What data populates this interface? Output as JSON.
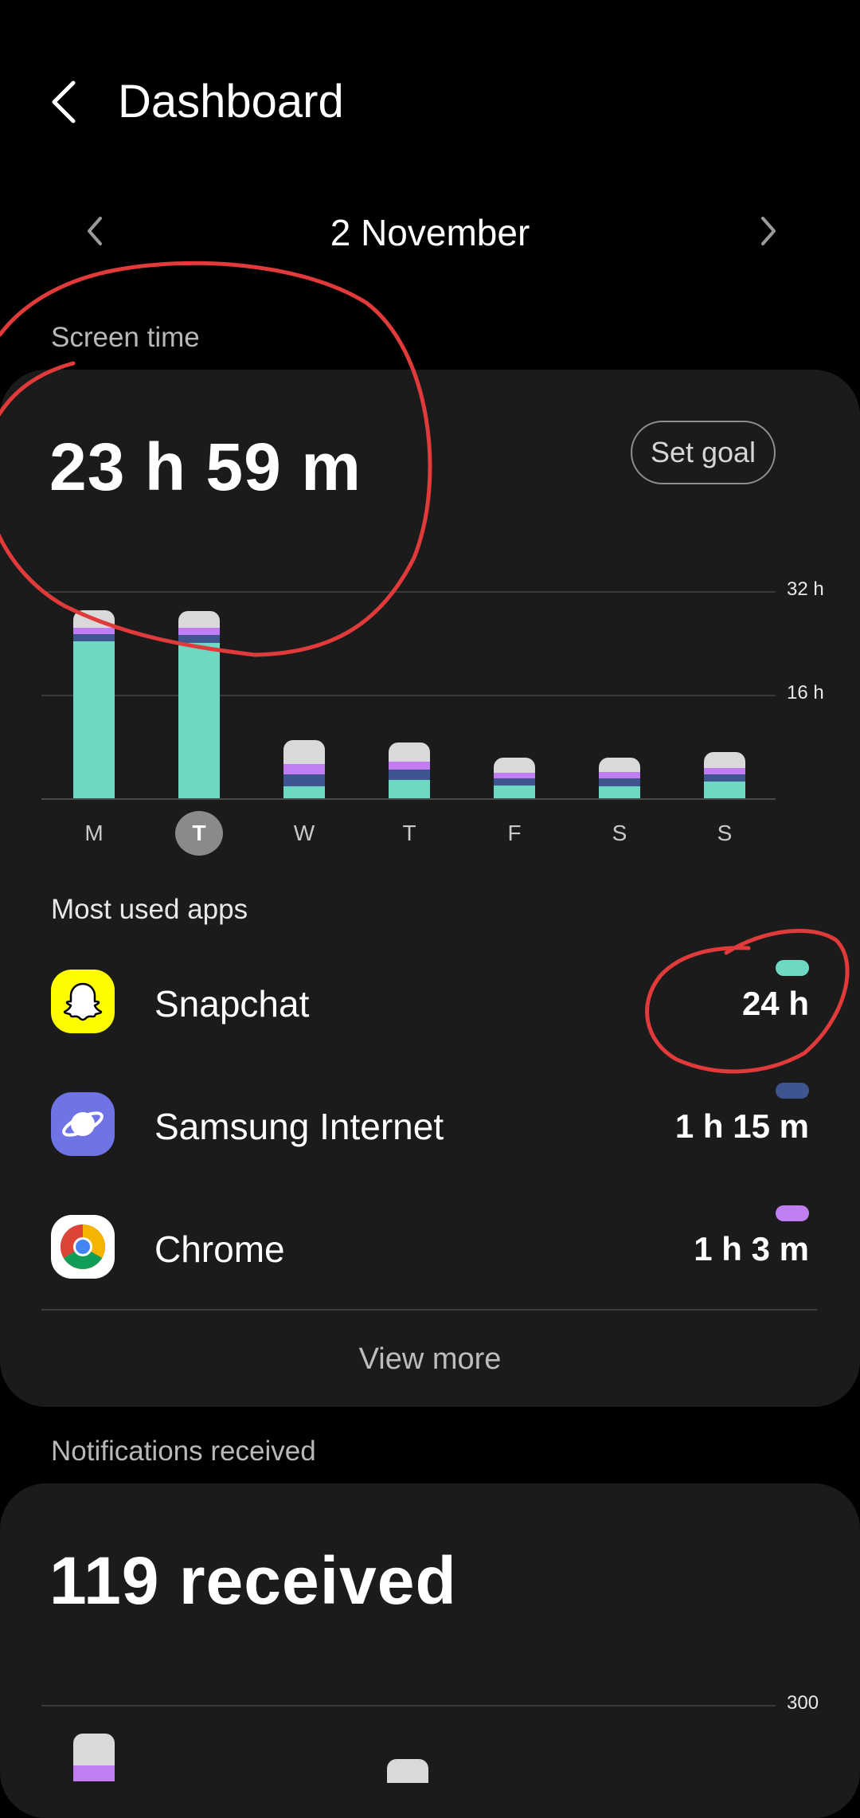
{
  "header": {
    "title": "Dashboard",
    "back_icon": "chevron-left-icon"
  },
  "date_nav": {
    "label": "2 November",
    "prev_icon": "chevron-left-icon",
    "next_icon": "chevron-right-icon"
  },
  "screen_time": {
    "section_label": "Screen time",
    "total": "23 h 59 m",
    "goal_button": "Set goal",
    "chart": {
      "type": "bar",
      "y_max_hours": 32,
      "axis_labels": [
        "32 h",
        "16 h"
      ],
      "days": [
        "M",
        "T",
        "W",
        "T",
        "F",
        "S",
        "S"
      ],
      "selected_day_index": 1,
      "series_colors": {
        "snapchat": "#6ed8c3",
        "samsung_internet": "#3f5590",
        "chrome": "#c07ef2",
        "other": "#d9d9d9"
      },
      "stacks_hours": [
        {
          "snapchat": 24.3,
          "samsung_internet": 1.1,
          "chrome": 1.0,
          "other": 2.7
        },
        {
          "snapchat": 24.0,
          "samsung_internet": 1.25,
          "chrome": 1.05,
          "other": 2.6
        },
        {
          "snapchat": 1.9,
          "samsung_internet": 1.8,
          "chrome": 1.6,
          "other": 3.7
        },
        {
          "snapchat": 2.8,
          "samsung_internet": 1.6,
          "chrome": 1.3,
          "other": 2.9
        },
        {
          "snapchat": 2.0,
          "samsung_internet": 1.1,
          "chrome": 0.9,
          "other": 2.3
        },
        {
          "snapchat": 1.9,
          "samsung_internet": 1.2,
          "chrome": 1.0,
          "other": 2.2
        },
        {
          "snapchat": 2.6,
          "samsung_internet": 1.1,
          "chrome": 1.0,
          "other": 2.4
        }
      ]
    },
    "most_used_label": "Most used apps",
    "apps": [
      {
        "name": "Snapchat",
        "time": "24 h",
        "color": "#6ed8c3",
        "icon": "snapchat-icon"
      },
      {
        "name": "Samsung Internet",
        "time": "1 h 15 m",
        "color": "#3f5590",
        "icon": "samsung-internet-icon"
      },
      {
        "name": "Chrome",
        "time": "1 h 3 m",
        "color": "#c07ef2",
        "icon": "chrome-icon"
      }
    ],
    "view_more": "View more"
  },
  "notifications": {
    "section_label": "Notifications received",
    "total": "119 received",
    "axis_label": "300"
  },
  "annotation_color": "#e03a3a"
}
